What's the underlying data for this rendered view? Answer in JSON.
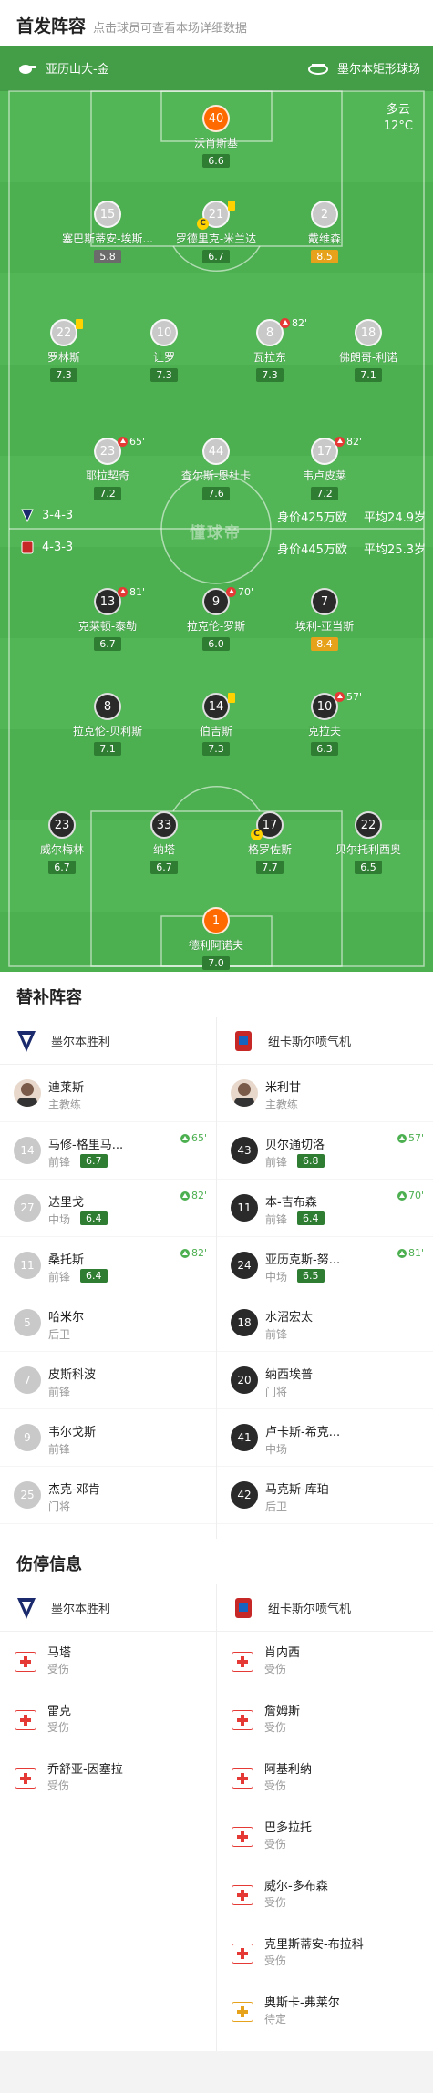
{
  "header": {
    "title": "首发阵容",
    "hint": "点击球员可查看本场详细数据"
  },
  "teams": {
    "home": "亚历山大-金",
    "away": "墨尔本矩形球场"
  },
  "weather": {
    "condition": "多云",
    "temp": "12°C"
  },
  "field_watermark": "懂球帝",
  "home_formation": {
    "formation": "3-4-3",
    "value": "身价425万欧",
    "age": "平均24.9岁"
  },
  "away_formation": {
    "formation": "4-3-3",
    "value": "身价445万欧",
    "age": "平均25.3岁"
  },
  "players": [
    {
      "num": "40",
      "name": "沃肖斯基",
      "rating": "6.6",
      "team": "away-gk"
    },
    {
      "num": "15",
      "name": "塞巴斯蒂安-埃斯...",
      "rating": "5.8",
      "team": "away",
      "grey": true
    },
    {
      "num": "21",
      "name": "罗德里克-米兰达",
      "rating": "6.7",
      "team": "away",
      "card": true,
      "captain": "C"
    },
    {
      "num": "2",
      "name": "戴维森",
      "rating": "8.5",
      "team": "away",
      "gold": true
    },
    {
      "num": "22",
      "name": "罗林斯",
      "rating": "7.3",
      "team": "away",
      "card": true
    },
    {
      "num": "10",
      "name": "让罗",
      "rating": "7.3",
      "team": "away"
    },
    {
      "num": "8",
      "name": "瓦拉东",
      "rating": "7.3",
      "team": "away",
      "sub": "82'"
    },
    {
      "num": "18",
      "name": "佛朗哥-利诺",
      "rating": "7.1",
      "team": "away"
    },
    {
      "num": "23",
      "name": "耶拉契奇",
      "rating": "7.2",
      "team": "away",
      "sub": "65'"
    },
    {
      "num": "44",
      "name": "查尔斯-恩杜卡",
      "rating": "7.6",
      "team": "away"
    },
    {
      "num": "17",
      "name": "韦卢皮莱",
      "rating": "7.2",
      "team": "away",
      "sub": "82'"
    },
    {
      "num": "13",
      "name": "克莱顿-泰勒",
      "rating": "6.7",
      "team": "home",
      "sub": "81'"
    },
    {
      "num": "9",
      "name": "拉克伦-罗斯",
      "rating": "6.0",
      "team": "home",
      "sub": "70'"
    },
    {
      "num": "7",
      "name": "埃利-亚当斯",
      "rating": "8.4",
      "team": "home",
      "gold": true
    },
    {
      "num": "8",
      "name": "拉克伦-贝利斯",
      "rating": "7.1",
      "team": "home"
    },
    {
      "num": "14",
      "name": "伯吉斯",
      "rating": "7.3",
      "team": "home",
      "card": true
    },
    {
      "num": "10",
      "name": "克拉夫",
      "rating": "6.3",
      "team": "home",
      "sub": "57'"
    },
    {
      "num": "23",
      "name": "威尔梅林",
      "rating": "6.7",
      "team": "home"
    },
    {
      "num": "33",
      "name": "纳塔",
      "rating": "6.7",
      "team": "home"
    },
    {
      "num": "17",
      "name": "格罗佐斯",
      "rating": "7.7",
      "team": "home",
      "captain": "C"
    },
    {
      "num": "22",
      "name": "贝尔托利西奥",
      "rating": "6.5",
      "team": "home"
    },
    {
      "num": "1",
      "name": "德利阿诺夫",
      "rating": "7.0",
      "team": "home-gk"
    }
  ],
  "subs_title": "替补阵容",
  "subs": {
    "home_team": "墨尔本胜利",
    "away_team": "纽卡斯尔喷气机",
    "home": [
      {
        "num": "",
        "name": "迪莱斯",
        "pos": "主教练",
        "coach": true
      },
      {
        "num": "14",
        "name": "马修-格里马...",
        "pos": "前锋",
        "rating": "6.7",
        "min": "65'"
      },
      {
        "num": "27",
        "name": "达里戈",
        "pos": "中场",
        "rating": "6.4",
        "min": "82'"
      },
      {
        "num": "11",
        "name": "桑托斯",
        "pos": "前锋",
        "rating": "6.4",
        "min": "82'"
      },
      {
        "num": "5",
        "name": "哈米尔",
        "pos": "后卫"
      },
      {
        "num": "7",
        "name": "皮斯科波",
        "pos": "前锋"
      },
      {
        "num": "9",
        "name": "韦尔戈斯",
        "pos": "前锋"
      },
      {
        "num": "25",
        "name": "杰克-邓肯",
        "pos": "门将"
      }
    ],
    "away": [
      {
        "num": "",
        "name": "米利甘",
        "pos": "主教练",
        "coach": true
      },
      {
        "num": "43",
        "name": "贝尔通切洛",
        "pos": "前锋",
        "rating": "6.8",
        "min": "57'"
      },
      {
        "num": "11",
        "name": "本-吉布森",
        "pos": "前锋",
        "rating": "6.4",
        "min": "70'"
      },
      {
        "num": "24",
        "name": "亚历克斯-努...",
        "pos": "中场",
        "rating": "6.5",
        "min": "81'"
      },
      {
        "num": "18",
        "name": "水沼宏太",
        "pos": "前锋"
      },
      {
        "num": "20",
        "name": "纳西埃普",
        "pos": "门将"
      },
      {
        "num": "41",
        "name": "卢卡斯-希克...",
        "pos": "中场"
      },
      {
        "num": "42",
        "name": "马克斯-库珀",
        "pos": "后卫"
      }
    ]
  },
  "injury_title": "伤停信息",
  "injuries": {
    "home": [
      {
        "name": "马塔",
        "status": "受伤"
      },
      {
        "name": "雷克",
        "status": "受伤"
      },
      {
        "name": "乔舒亚-因塞拉",
        "status": "受伤"
      }
    ],
    "away": [
      {
        "name": "肖内西",
        "status": "受伤"
      },
      {
        "name": "詹姆斯",
        "status": "受伤"
      },
      {
        "name": "阿基利纳",
        "status": "受伤"
      },
      {
        "name": "巴多拉托",
        "status": "受伤"
      },
      {
        "name": "威尔-多布森",
        "status": "受伤"
      },
      {
        "name": "克里斯蒂安-布拉科",
        "status": "受伤"
      },
      {
        "name": "奥斯卡-弗莱尔",
        "status": "待定",
        "pending": true
      }
    ]
  },
  "colors": {
    "pitch": "#4caf50",
    "rating": "#2e7d32",
    "gold": "#e6a21a",
    "gk": "#ff6a00"
  }
}
